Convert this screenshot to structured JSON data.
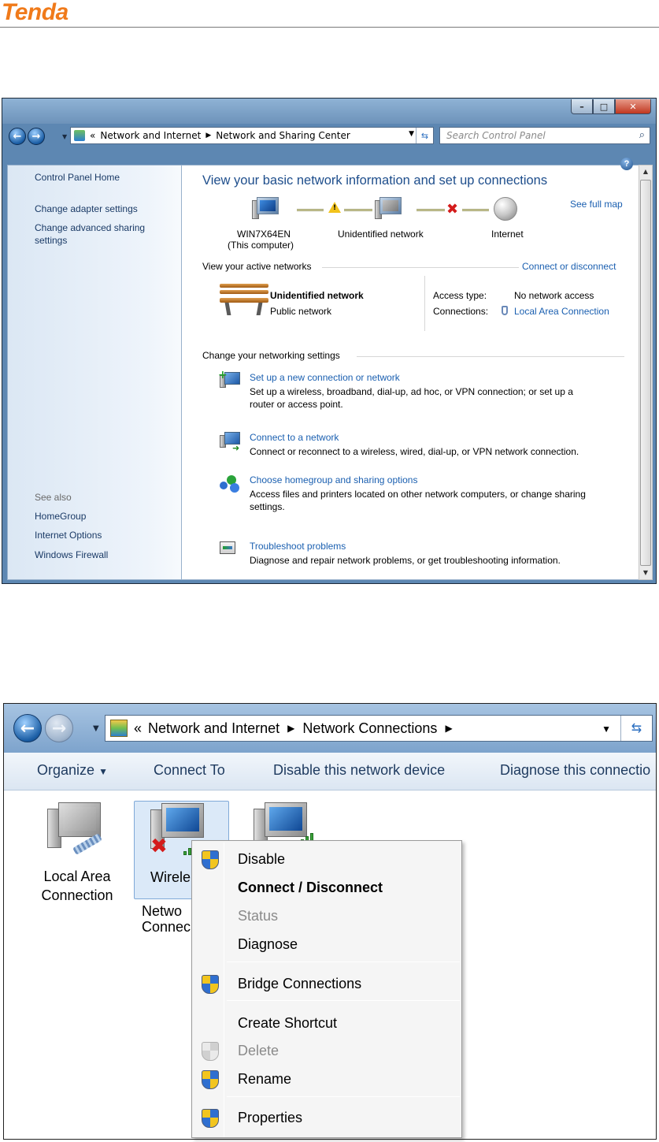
{
  "header": {
    "logo": "Tenda"
  },
  "window1": {
    "address": {
      "crumbs": [
        "Network and Internet",
        "Network and Sharing Center"
      ],
      "chevrons": "«"
    },
    "search_placeholder": "Search Control Panel",
    "left_pane": {
      "links": [
        "Control Panel Home",
        "Change adapter settings",
        "Change advanced sharing settings"
      ],
      "see_also_label": "See also",
      "see_also": [
        "HomeGroup",
        "Internet Options",
        "Windows Firewall"
      ]
    },
    "content": {
      "title": "View your basic network information and set up connections",
      "see_full_map": "See full map",
      "map": {
        "computer_name": "WIN7X64EN",
        "computer_sub": "(This computer)",
        "network": "Unidentified network",
        "internet": "Internet"
      },
      "active_networks_label": "View your active networks",
      "connect_disconnect": "Connect or disconnect",
      "network_name": "Unidentified network",
      "network_type": "Public network",
      "access_type_label": "Access type:",
      "access_type_value": "No network access",
      "connections_label": "Connections:",
      "connections_value": "Local Area Connection",
      "change_settings_label": "Change your networking settings",
      "tasks": [
        {
          "title": "Set up a new connection or network",
          "desc1": "Set up a wireless, broadband, dial-up, ad hoc, or VPN connection; or set up a",
          "desc2": "router or access point."
        },
        {
          "title": "Connect to a network",
          "desc1": "Connect or reconnect to a wireless, wired, dial-up, or VPN network connection.",
          "desc2": ""
        },
        {
          "title": "Choose homegroup and sharing options",
          "desc1": "Access files and printers located on other network computers, or change sharing",
          "desc2": "settings."
        },
        {
          "title": "Troubleshoot problems",
          "desc1": "Diagnose and repair network problems, or get troubleshooting information.",
          "desc2": ""
        }
      ]
    }
  },
  "window2": {
    "address": {
      "crumbs": [
        "Network and Internet",
        "Network Connections"
      ],
      "chevrons": "«"
    },
    "toolbar": {
      "organize": "Organize",
      "connect_to": "Connect To",
      "disable": "Disable this network device",
      "diagnose": "Diagnose this connectio"
    },
    "items": {
      "local_line1": "Local Area",
      "local_line2": "Connection",
      "wireless_line1": "Wirele",
      "wireless_line2": "Netwo",
      "wireless_line3": "Connec"
    },
    "context_menu": {
      "disable": "Disable",
      "connect_disconnect": "Connect / Disconnect",
      "status": "Status",
      "diagnose": "Diagnose",
      "bridge": "Bridge Connections",
      "create_shortcut": "Create Shortcut",
      "delete": "Delete",
      "rename": "Rename",
      "properties": "Properties"
    }
  }
}
